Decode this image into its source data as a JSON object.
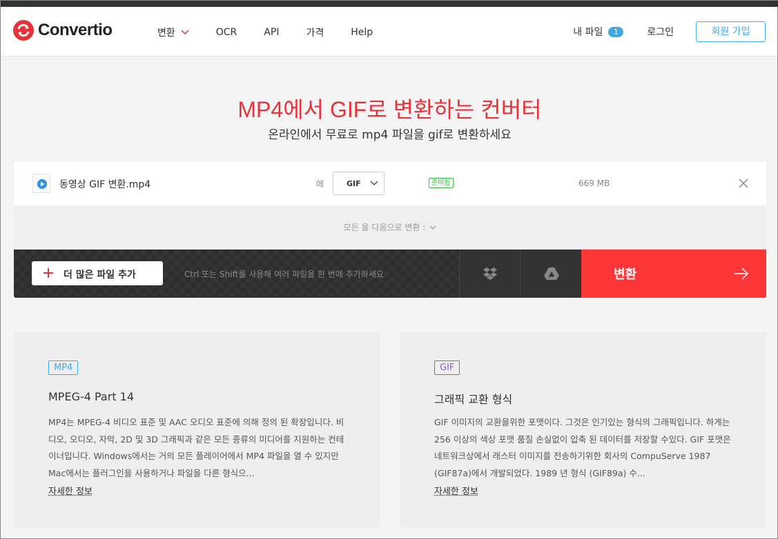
{
  "header": {
    "logo_text": "Convertio",
    "nav": [
      {
        "label": "변환",
        "has_dropdown": true
      },
      {
        "label": "OCR"
      },
      {
        "label": "API"
      },
      {
        "label": "가격"
      },
      {
        "label": "Help"
      }
    ],
    "my_files_label": "내 파일",
    "my_files_count": "1",
    "login_label": "로그인",
    "signup_label": "회원 가입"
  },
  "hero": {
    "title": "MP4에서 GIF로 변환하는 컨버터",
    "subtitle": "온라인에서 무료로 mp4 파일을 gif로 변환하세요"
  },
  "file": {
    "name": "동영상 GIF 변환.mp4",
    "to_label": "에",
    "format": "GIF",
    "status": "준비됨",
    "size": "669 MB"
  },
  "convert_all_label": "모든 을 다음으로 변환 :",
  "actionbar": {
    "add_files_label": "더 많은 파일 추가",
    "hint": "Ctrl 또는 Shift를 사용해 여러 파일을 한 번에 추가하세요",
    "convert_label": "변환"
  },
  "info_cards": [
    {
      "tag": "MP4",
      "title": "MPEG-4 Part 14",
      "description": "MP4는 MPEG-4 비디오 표준 및 AAC 오디오 표준에 의해 정의 된 확장입니다. 비디오, 오디오, 자막, 2D 및 3D 그래픽과 같은 모든 종류의 미디어를 지원하는 컨테이너입니다. Windows에서는 거의 모든 플레이어에서 MP4 파일을 열 수 있지만 Mac에서는 플러그인을 사용하거나 파일을 다른 형식으...",
      "more": "자세한 정보"
    },
    {
      "tag": "GIF",
      "title": "그래픽 교환 형식",
      "description": "GIF 이미지의 교환을위한 포맷이다. 그것은 인기있는 형식의 그래픽입니다. 하게는 256 이상의 색상 포맷 품질 손실없이 압축 된 데이터를 저장할 수있다. GIF 포맷은 네트워크상에서 래스터 이미지를 전송하기위한 회사의 CompuServe 1987 (GIF87a)에서 개발되었다. 1989 년 형식 (GIF89a) 수...",
      "more": "자세한 정보"
    }
  ],
  "colors": {
    "brand_red": "#e8323a",
    "convert_red": "#ff3637",
    "accent_blue": "#3fa9e8",
    "ready_green": "#3cb34a",
    "mp4_tag": "#3fa9e8",
    "gif_tag": "#8e5fc9"
  }
}
